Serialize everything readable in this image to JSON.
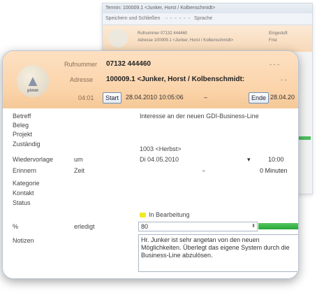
{
  "bg_window": {
    "title": "Termin: 100009.1 <Junker, Horst / Kolbenschmidt>",
    "toolbar_label": "Speichern und Schließen",
    "toolbar_right": "Sprache",
    "lines": [
      "Rufnummer 07132 444460",
      "Adresse 100009.1 <Junker, Horst / Kolbenschmidt>"
    ],
    "right": [
      "Eingestuft",
      "Frist"
    ]
  },
  "header": {
    "logo_text": "pimm",
    "rufnummer_label": "Rufnummer",
    "rufnummer_value": "07132 444460",
    "adresse_label": "Adresse",
    "adresse_value": "100009.1 <Junker, Horst / Kolbenschmidt:",
    "time_label": "04:01",
    "start_button": "Start",
    "start_datetime": "28.04.2010 10:05:06",
    "separator": "–",
    "ende_button": "Ende",
    "ende_datetime": "28.04.20",
    "dashes1": "- - -",
    "dashes2": "- -"
  },
  "fields": {
    "betreff_label": "Betreff",
    "betreff_value": "Interesse an der neuen GDI-Business-Line",
    "beleg_label": "Beleg",
    "projekt_label": "Projekt",
    "zustaendig_label": "Zuständig",
    "zustaendig_value": "1003 <Herbst>",
    "wiedervorlage_label": "Wiedervorlage",
    "wiedervorlage_sub": "um",
    "wiedervorlage_date": "Di 04.05.2010",
    "wiedervorlage_time": "10:00",
    "erinnern_label": "Erinnern",
    "erinnern_sub": "Zeit",
    "erinnern_value": "0 Minuten",
    "kategorie_label": "Kategorie",
    "kontakt_label": "Kontakt",
    "status_label": "Status",
    "status_value": "In Bearbeitung",
    "percent_label": "%",
    "percent_sub": "erledigt",
    "percent_value": "80",
    "notizen_label": "Notizen",
    "notizen_value": "Hr. Junker ist sehr angetan von den neuen Möglichkeiten. Überlegt das eigene System durch die Business-Line abzulösen."
  },
  "colors": {
    "header_bg": "#fbd3a9",
    "status_yellow": "#f0ea21",
    "progress_green": "#27a737"
  }
}
